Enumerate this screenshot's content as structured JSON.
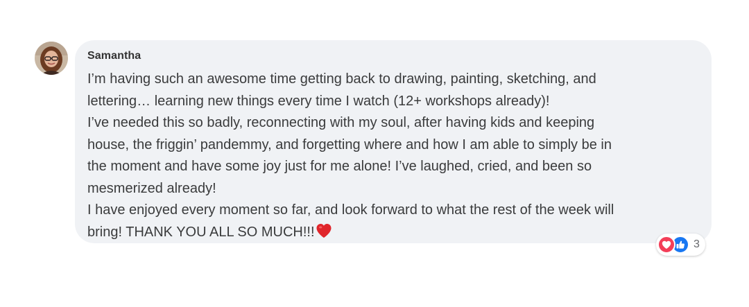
{
  "comment": {
    "author": "Samantha",
    "lines": [
      "I’m having such an awesome time getting back to drawing, painting, sketching, and",
      "lettering… learning new things every time I watch (12+ workshops already)!",
      "I’ve needed this so badly, reconnecting with my soul, after having kids and keeping",
      "house, the friggin’ pandemmy, and forgetting where and how I am able to simply be in",
      "the moment and have some joy just for me alone! I’ve laughed, cried, and been so",
      "mesmerized already!",
      "I have enjoyed every moment so far, and look forward to what the rest of the week will",
      "bring! THANK YOU ALL SO MUCH!!!"
    ],
    "trailing_emoji": "red-heart-icon"
  },
  "reactions": {
    "icons": [
      "love-reaction-icon",
      "like-reaction-icon"
    ],
    "count": "3"
  },
  "colors": {
    "bubble": "#f0f2f5",
    "text": "#3a3b3c",
    "love": "#f33e58",
    "like": "#1877f2",
    "heart_emoji": "#e0252b"
  }
}
